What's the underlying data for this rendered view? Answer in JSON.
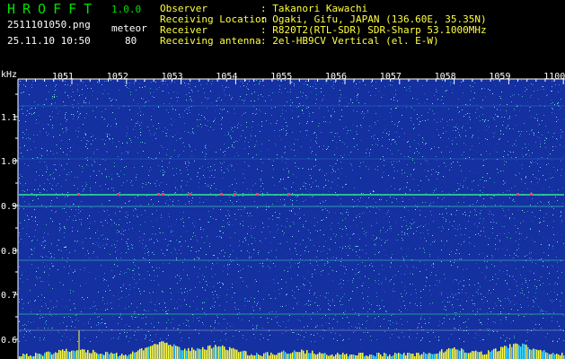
{
  "header": {
    "app_title": "HROFFT",
    "version": "1.0.0",
    "file_name": "2511101050.png",
    "detect_type": "meteor",
    "date_time": "25.11.10 10:50",
    "count": "80",
    "info": [
      {
        "label": "Observer",
        "value": ": Takanori Kawachi"
      },
      {
        "label": "Receiving Location",
        "value": ": Ogaki, Gifu, JAPAN (136.60E, 35.35N)"
      },
      {
        "label": "Receiver",
        "value": ": R820T2(RTL-SDR) SDR-Sharp 53.1000MHz"
      },
      {
        "label": "Receiving antenna",
        "value": ": 2el-HB9CV Vertical (el. E-W)"
      }
    ]
  },
  "spectrogram": {
    "y_unit": "kHz",
    "y_ticks": [
      "1.1",
      "1.0",
      "0.9",
      "0.8",
      "0.7",
      "0.6"
    ],
    "x_ticks": [
      "1051",
      "1052",
      "1053",
      "1054",
      "1055",
      "1056",
      "1057",
      "1058",
      "1059",
      "1100"
    ],
    "colors": {
      "background": "#1530a0",
      "axis": "#ffffff",
      "signal": "#30ff90",
      "strong": "#ff4050",
      "baseline": "#ffff40"
    }
  }
}
